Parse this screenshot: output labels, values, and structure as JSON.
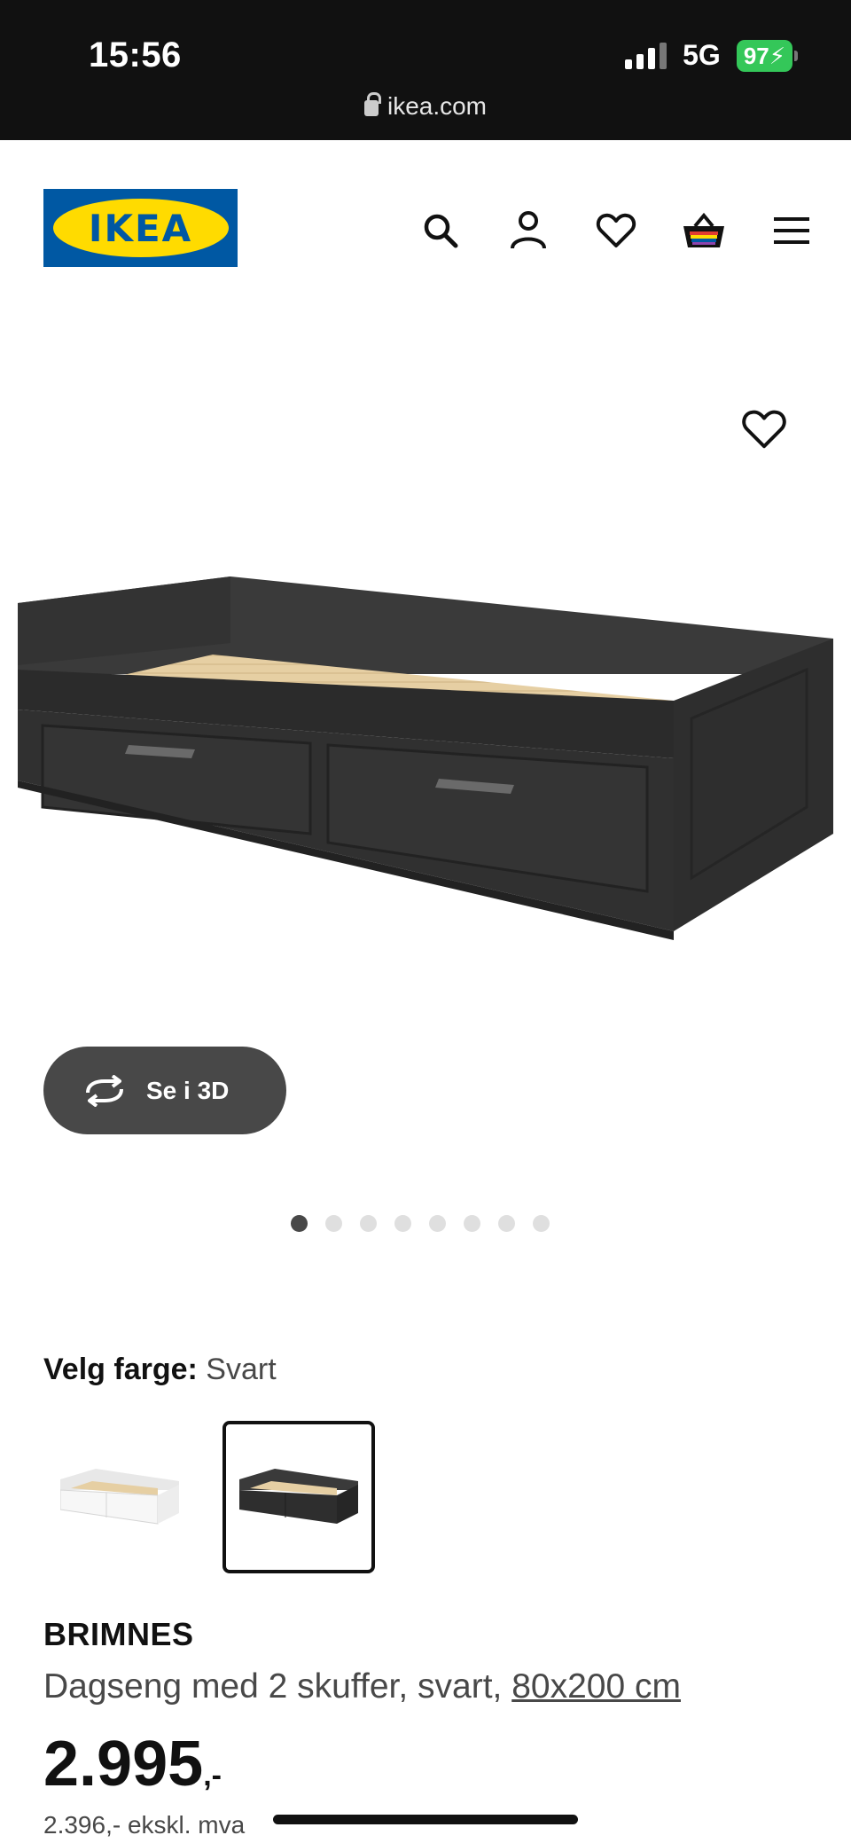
{
  "status_bar": {
    "time": "15:56",
    "network": "5G",
    "battery": "97",
    "url": "ikea.com"
  },
  "header": {
    "logo_text": "IKEA",
    "icons": [
      "search-icon",
      "user-icon",
      "heart-icon",
      "basket-icon",
      "menu-icon"
    ]
  },
  "gallery": {
    "view3d_label": "Se i 3D",
    "image_count": 8,
    "active_index": 0
  },
  "color": {
    "label": "Velg farge:",
    "value": "Svart",
    "options": [
      "hvit",
      "svart"
    ]
  },
  "product": {
    "name": "BRIMNES",
    "description": "Dagseng med 2 skuffer, svart, ",
    "size_link": "80x200 cm",
    "price_main": "2.995",
    "price_suffix": ",-",
    "price_ex_vat": "2.396,- ekskl. mva"
  },
  "colors": {
    "ikea_blue": "#0058a3",
    "ikea_yellow": "#ffdb00",
    "dark_grey": "#484848",
    "battery_green": "#34c759"
  }
}
